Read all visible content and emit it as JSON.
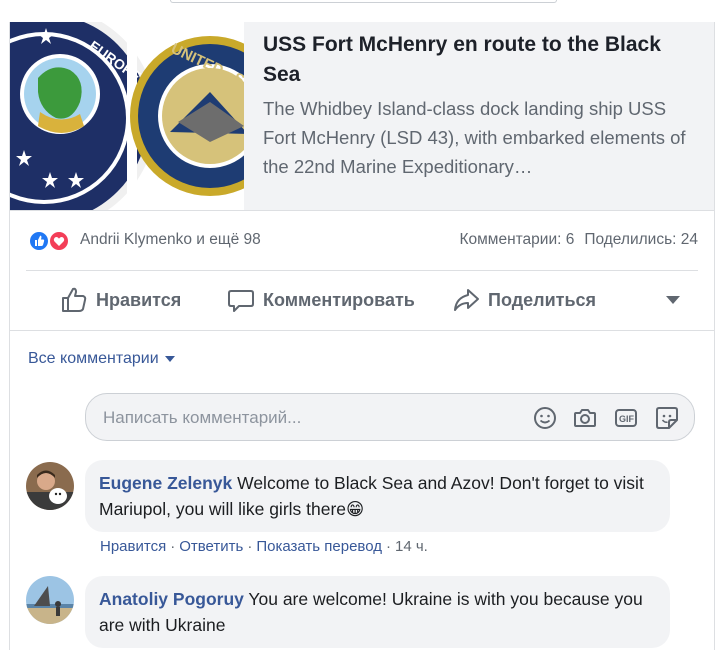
{
  "link_preview": {
    "title": "USS Fort McHenry en route to the Black Sea",
    "description": "The Whidbey Island-class dock landing ship USS Fort McHenry (LSD 43), with embarked elements of the 22nd Marine Expeditionary…",
    "thumbnail_left_text": "EUROPE · AFRICA · FORCES AFRICA",
    "thumbnail_right_text": "UNITED · SIXTH"
  },
  "reactions": {
    "icons": [
      "like-icon",
      "love-icon"
    ],
    "names": "Andrii Klymenko и ещё 98",
    "comments_count": "Комментарии: 6",
    "shares_count": "Поделились: 24"
  },
  "actions": {
    "like_label": "Нравится",
    "comment_label": "Комментировать",
    "share_label": "Поделиться"
  },
  "comments_filter": {
    "label": "Все комментарии"
  },
  "composer": {
    "placeholder": "Написать комментарий...",
    "icons": [
      "emoji-icon",
      "camera-icon",
      "gif-icon",
      "sticker-icon"
    ]
  },
  "comments": [
    {
      "author": "Eugene Zelenyk",
      "text": "Welcome to Black Sea and Azov! Don't forget to visit Mariupol, you will like girls there😁",
      "like_label": "Нравится",
      "reply_label": "Ответить",
      "translate_label": "Показать перевод",
      "time": "14 ч."
    },
    {
      "author": "Anatoliy Pogoruy",
      "text": "You are welcome! Ukraine is with you because you are with Ukraine"
    }
  ],
  "colors": {
    "link_blue": "#385898",
    "secondary_text": "#606770",
    "bubble_bg": "#f2f3f5",
    "like_blue": "#2078f4",
    "love_red": "#f33e58"
  }
}
